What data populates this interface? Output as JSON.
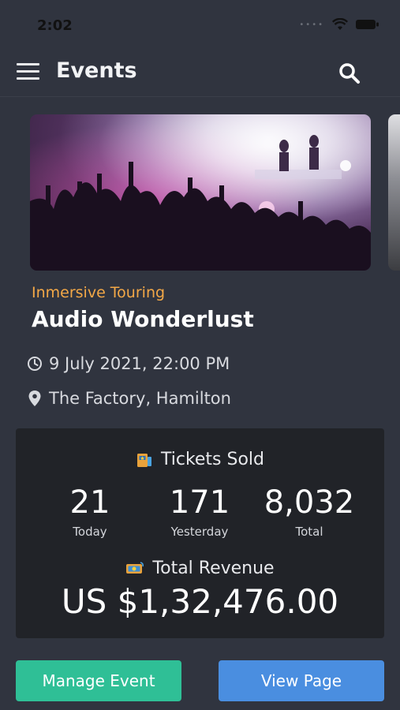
{
  "status_bar": {
    "time": "2:02"
  },
  "header": {
    "title": "Events"
  },
  "event": {
    "subtitle": "Inmersive Touring",
    "title": "Audio Wonderlust",
    "datetime": "9 July 2021, 22:00 PM",
    "location": "The Factory, Hamilton"
  },
  "stats": {
    "tickets_heading": "Tickets Sold",
    "today_value": "21",
    "today_label": "Today",
    "yesterday_value": "171",
    "yesterday_label": "Yesterday",
    "total_value": "8,032",
    "total_label": "Total",
    "revenue_heading": "Total Revenue",
    "revenue_amount": "US $1,32,476.00"
  },
  "actions": {
    "manage_label": "Manage Event",
    "view_label": "View Page"
  },
  "colors": {
    "background": "#30343f",
    "card": "#212328",
    "accent_orange": "#f3a847",
    "manage_button": "#2fbf96",
    "view_button": "#4a8ee0"
  },
  "icons": [
    "menu-icon",
    "search-icon",
    "clock-icon",
    "location-pin-icon",
    "ticket-icon",
    "money-icon",
    "wifi-icon",
    "battery-icon"
  ]
}
